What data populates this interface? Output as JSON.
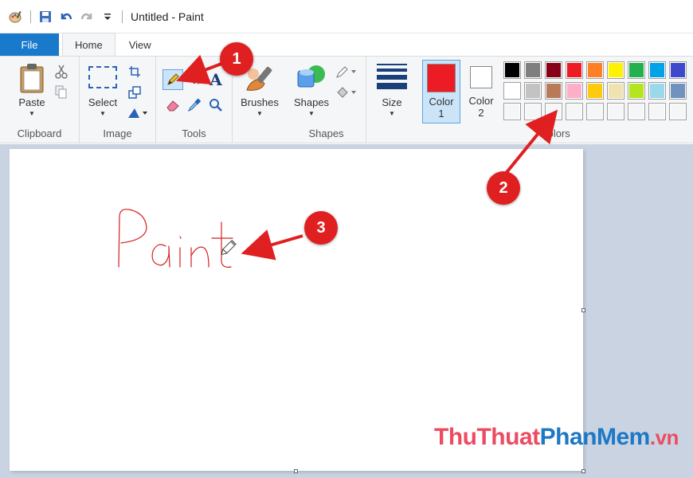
{
  "window": {
    "title": "Untitled - Paint"
  },
  "tabs": {
    "file": "File",
    "home": "Home",
    "view": "View"
  },
  "ribbon": {
    "clipboard": {
      "label": "Clipboard",
      "paste": "Paste"
    },
    "image": {
      "label": "Image",
      "select": "Select"
    },
    "tools": {
      "label": "Tools"
    },
    "brushes": {
      "label": "Brushes"
    },
    "shapes": {
      "label": "Shapes",
      "button": "Shapes"
    },
    "size": {
      "label": "Size"
    },
    "colors": {
      "label": "Colors",
      "color1_label": "Color",
      "color1_num": "1",
      "color2_label": "Color",
      "color2_num": "2",
      "color1_value": "#ec1c24",
      "color2_value": "#ffffff",
      "row1": [
        "#000000",
        "#7f7f7f",
        "#880015",
        "#ed1c24",
        "#ff7f27",
        "#fff200",
        "#22b14c",
        "#00a2e8",
        "#3f48cc"
      ],
      "row2": [
        "#ffffff",
        "#c3c3c3",
        "#b97a57",
        "#ffaec9",
        "#ffc90e",
        "#efe4b0",
        "#b5e61d",
        "#99d9ea",
        "#7092be"
      ],
      "row3": [
        "#f5f6f7",
        "#f5f6f7",
        "#f5f6f7",
        "#f5f6f7",
        "#f5f6f7",
        "#f5f6f7",
        "#f5f6f7",
        "#f5f6f7",
        "#f5f6f7"
      ]
    }
  },
  "canvas": {
    "drawn_text": "Paint"
  },
  "annotations": {
    "b1": "1",
    "b2": "2",
    "b3": "3"
  },
  "watermark": {
    "part1": "ThuThuat",
    "part2": "PhanMem",
    "part3": ".vn"
  }
}
